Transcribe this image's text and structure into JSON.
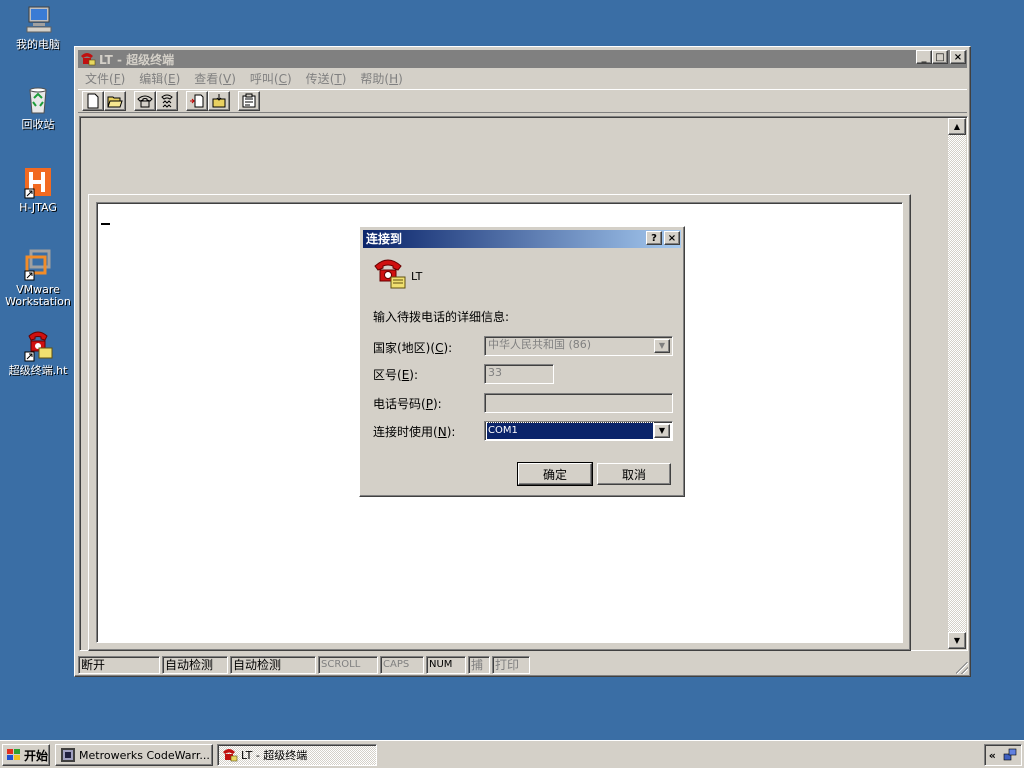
{
  "desktop": {
    "icons": [
      {
        "label": "我的电脑"
      },
      {
        "label": "回收站"
      },
      {
        "label": "H-JTAG"
      },
      {
        "label": "VMware Workstation"
      },
      {
        "label": "超级终端.ht"
      }
    ]
  },
  "window": {
    "title": "LT - 超级终端",
    "menu": [
      {
        "label": "文件",
        "key": "F"
      },
      {
        "label": "编辑",
        "key": "E"
      },
      {
        "label": "查看",
        "key": "V"
      },
      {
        "label": "呼叫",
        "key": "C"
      },
      {
        "label": "传送",
        "key": "T"
      },
      {
        "label": "帮助",
        "key": "H"
      }
    ],
    "status": [
      "断开",
      "自动检测",
      "自动检测",
      "SCROLL",
      "CAPS",
      "NUM",
      "捕",
      "打印"
    ]
  },
  "dialog": {
    "title": "连接到",
    "connection_name": "LT",
    "prompt": "输入待拨电话的详细信息:",
    "country_label": "国家(地区)",
    "country_key": "C",
    "country_value": "中华人民共和国 (86)",
    "area_label": "区号",
    "area_key": "E",
    "area_value": "33",
    "phone_label": "电话号码",
    "phone_key": "P",
    "phone_value": "",
    "connect_label": "连接时使用",
    "connect_key": "N",
    "connect_value": "COM1",
    "ok_label": "确定",
    "cancel_label": "取消"
  },
  "taskbar": {
    "start_label": "开始",
    "tasks": [
      {
        "label": "Metrowerks CodeWarr..."
      },
      {
        "label": "LT - 超级终端"
      }
    ],
    "tray_chevron": "«"
  },
  "colors": {
    "desktop": "#3a6ea5",
    "face": "#d4d0c8",
    "active_title_start": "#0a246a",
    "active_title_end": "#a6caf0",
    "inactive_title": "#808080",
    "selection": "#0a246a"
  }
}
